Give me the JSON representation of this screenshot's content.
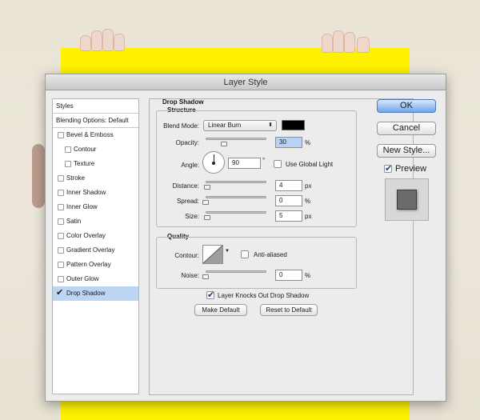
{
  "window": {
    "title": "Layer Style"
  },
  "sidebar": {
    "header": "Styles",
    "blending": "Blending Options: Default",
    "items": [
      {
        "label": "Bevel & Emboss",
        "checked": false,
        "sub": false
      },
      {
        "label": "Contour",
        "checked": false,
        "sub": true
      },
      {
        "label": "Texture",
        "checked": false,
        "sub": true
      },
      {
        "label": "Stroke",
        "checked": false,
        "sub": false
      },
      {
        "label": "Inner Shadow",
        "checked": false,
        "sub": false
      },
      {
        "label": "Inner Glow",
        "checked": false,
        "sub": false
      },
      {
        "label": "Satin",
        "checked": false,
        "sub": false
      },
      {
        "label": "Color Overlay",
        "checked": false,
        "sub": false
      },
      {
        "label": "Gradient Overlay",
        "checked": false,
        "sub": false
      },
      {
        "label": "Pattern Overlay",
        "checked": false,
        "sub": false
      },
      {
        "label": "Outer Glow",
        "checked": false,
        "sub": false
      },
      {
        "label": "Drop Shadow",
        "checked": true,
        "sub": false,
        "selected": true
      }
    ]
  },
  "panel": {
    "title": "Drop Shadow",
    "structure": {
      "title": "Structure",
      "blend_mode_label": "Blend Mode:",
      "blend_mode_value": "Linear Burn",
      "shadow_color": "#000000",
      "opacity_label": "Opacity:",
      "opacity_value": "30",
      "opacity_unit": "%",
      "opacity_level": 0.3,
      "angle_label": "Angle:",
      "angle_value": "90",
      "angle_unit": "°",
      "global_light_label": "Use Global Light",
      "distance_label": "Distance:",
      "distance_value": "4",
      "distance_unit": "px",
      "spread_label": "Spread:",
      "spread_value": "0",
      "spread_unit": "%",
      "size_label": "Size:",
      "size_value": "5",
      "size_unit": "px"
    },
    "quality": {
      "title": "Quality",
      "contour_label": "Contour:",
      "anti_aliased_label": "Anti-aliased",
      "noise_label": "Noise:",
      "noise_value": "0",
      "noise_unit": "%"
    },
    "knockout_label": "Layer Knocks Out Drop Shadow",
    "make_default": "Make Default",
    "reset_default": "Reset to Default"
  },
  "buttons": {
    "ok": "OK",
    "cancel": "Cancel",
    "new_style": "New Style...",
    "preview": "Preview"
  },
  "colors": {
    "accent": "#6ea8ec",
    "board": "#fff200",
    "selection": "#bcd5f3"
  }
}
